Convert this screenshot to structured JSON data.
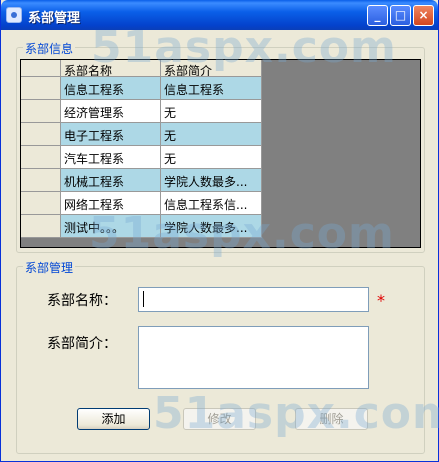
{
  "window": {
    "title": "系部管理"
  },
  "info_group": {
    "legend": "系部信息",
    "columns": [
      "系部名称",
      "系部简介"
    ],
    "rows": [
      [
        "信息工程系",
        "信息工程系"
      ],
      [
        "经济管理系",
        "无"
      ],
      [
        "电子工程系",
        "无"
      ],
      [
        "汽车工程系",
        "无"
      ],
      [
        "机械工程系",
        "学院人数最多..."
      ],
      [
        "网络工程系",
        "信息工程系信..."
      ],
      [
        "测试中。。。",
        "学院人数最多..."
      ]
    ]
  },
  "manage_group": {
    "legend": "系部管理",
    "name_label": "系部名称：",
    "name_value": "",
    "required_mark": "*",
    "desc_label": "系部简介：",
    "desc_value": ""
  },
  "buttons": {
    "add": "添加",
    "edit": "修改",
    "delete": "删除"
  },
  "watermark": "51aspx.com",
  "colors": {
    "row_alt": "#add8e6",
    "legend_text": "#0046d5",
    "required": "#e00000"
  }
}
